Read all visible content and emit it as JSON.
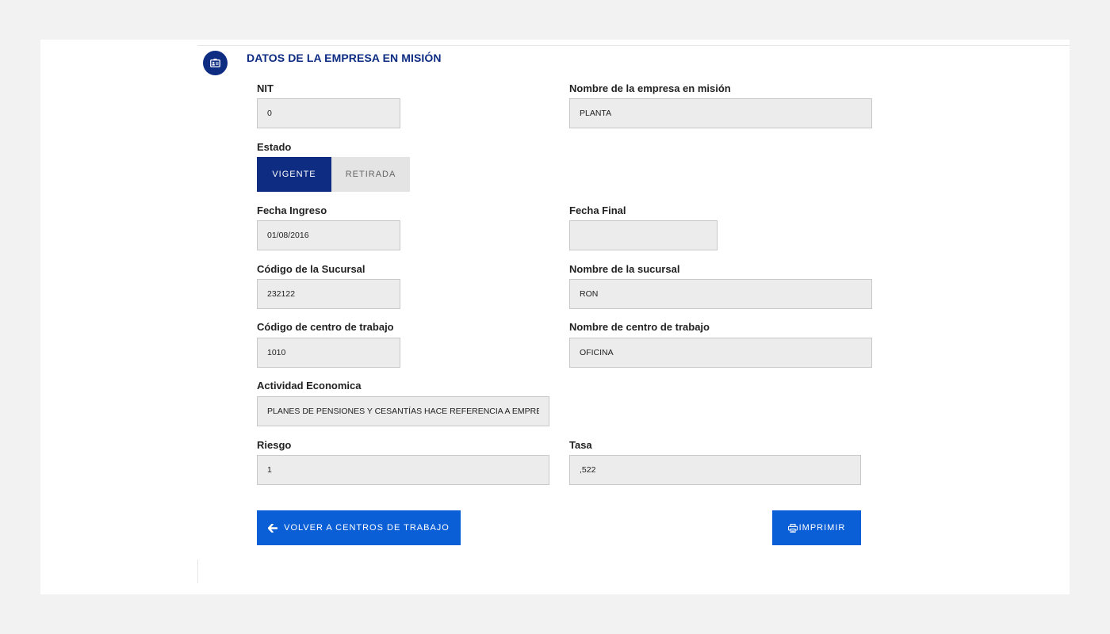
{
  "section": {
    "title": "DATOS DE LA EMPRESA EN MISIÓN",
    "icon": "id-card-icon"
  },
  "form": {
    "nit": {
      "label": "NIT",
      "value": "0"
    },
    "empresa": {
      "label": "Nombre de la empresa en misión",
      "value": "PLANTA"
    },
    "estado": {
      "label": "Estado",
      "options": [
        "VIGENTE",
        "RETIRADA"
      ],
      "selected": "VIGENTE"
    },
    "fecha_ingreso": {
      "label": "Fecha Ingreso",
      "value": "01/08/2016"
    },
    "fecha_final": {
      "label": "Fecha Final",
      "value": ""
    },
    "codigo_sucursal": {
      "label": "Código de la Sucursal",
      "value": "232122"
    },
    "nombre_sucursal": {
      "label": "Nombre de la sucursal",
      "value": "RON"
    },
    "codigo_centro": {
      "label": "Código de centro de trabajo",
      "value": "1010"
    },
    "nombre_centro": {
      "label": "Nombre de centro de trabajo",
      "value": "OFICINA"
    },
    "actividad": {
      "label": "Actividad Economica",
      "value": "PLANES DE PENSIONES Y CESANTÍAS HACE REFERENCIA A EMPRESAS DEDICADA"
    },
    "riesgo": {
      "label": "Riesgo",
      "value": "1"
    },
    "tasa": {
      "label": "Tasa",
      "value": ",522"
    }
  },
  "actions": {
    "back_label": "VOLVER A CENTROS DE TRABAJO",
    "back_icon": "arrow-left-icon",
    "print_label": "IMPRIMIR",
    "print_icon": "printer-icon"
  },
  "colors": {
    "primary_dark": "#0d2c82",
    "action_blue": "#0a5fd6",
    "field_bg": "#ececec",
    "page_bg": "#f2f2f2"
  }
}
